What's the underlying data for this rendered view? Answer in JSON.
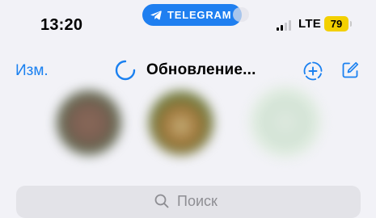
{
  "status_bar": {
    "time": "13:20",
    "app_pill": "TELEGRAM",
    "network": "LTE",
    "battery_level": "79",
    "signal_bars_filled": 2,
    "signal_bars_total": 4
  },
  "nav": {
    "edit_label": "Изм.",
    "title": "Обновление...",
    "icons": [
      "loading-spinner-icon",
      "add-story-icon",
      "compose-icon"
    ]
  },
  "stories": {
    "count": 3
  },
  "search": {
    "placeholder": "Поиск"
  },
  "colors": {
    "accent": "#1a80f0",
    "pill": "#1f7ff0",
    "battery": "#f3d000",
    "background": "#f2f2f7",
    "search_field": "#e3e3e8",
    "placeholder": "#8e8e93"
  }
}
